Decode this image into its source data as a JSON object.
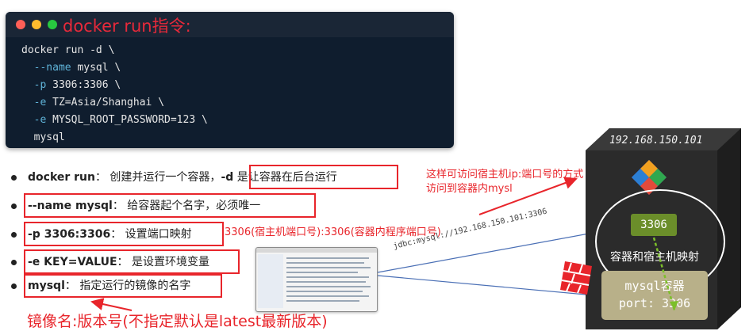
{
  "terminal": {
    "title": "docker run指令:",
    "lines": [
      {
        "opt": "",
        "rest": "docker run -d \\"
      },
      {
        "opt": "--name",
        "rest": " mysql \\"
      },
      {
        "opt": "-p",
        "rest": " 3306:3306 \\"
      },
      {
        "opt": "-e",
        "rest": " TZ=Asia/Shanghai \\"
      },
      {
        "opt": "-e",
        "rest": " MYSQL_ROOT_PASSWORD=123 \\"
      },
      {
        "opt": "",
        "rest": "mysql"
      }
    ]
  },
  "bullets": [
    {
      "term": "docker run",
      "desc": "： 创建并运行一个容器，",
      "extra_term": "-d",
      "extra_desc": " 是让容器在后台运行"
    },
    {
      "term": "--name mysql",
      "desc": "： 给容器起个名字，必须唯一"
    },
    {
      "term": "-p 3306:3306",
      "desc": "： 设置端口映射"
    },
    {
      "term": "-e KEY=VALUE",
      "desc": "： 是设置环境变量"
    },
    {
      "term": "mysql",
      "desc": "： 指定运行的镜像的名字"
    }
  ],
  "annotations": {
    "port_note": "3306(宿主机端口号):3306(容器内程序端口号)",
    "access_note_1": "这样可访问宿主机ip:端口号的方式",
    "access_note_2": "访问到容器内mysl",
    "image_note": "镜像名:版本号(不指定默认是latest最新版本)"
  },
  "server": {
    "ip": "192.168.150.101",
    "host_port": "3306",
    "mapping_label": "容器和宿主机映射",
    "container_line1": "mysql容器",
    "container_line2": "port: 3306"
  },
  "jdbc_url": "jdbc:mysql://192.168.150.101:3306",
  "colors": {
    "annotation_red": "#e8252b",
    "terminal_bg": "#0f1d2e",
    "option_blue": "#5fb3d8",
    "port_green": "#6b8e2a",
    "container_tan": "#b8b089"
  },
  "icons": [
    "window-dots-icon",
    "docker-logo-icon",
    "db-client-screenshot",
    "firewall-icon"
  ]
}
